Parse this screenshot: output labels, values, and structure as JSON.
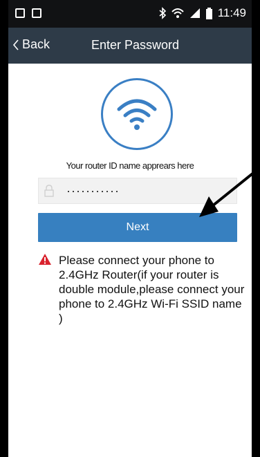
{
  "status_bar": {
    "time": "11:49"
  },
  "nav": {
    "back_label": "Back",
    "title": "Enter Password"
  },
  "main": {
    "router_label": "Your router ID name apprears here",
    "password_value": "···········",
    "next_label": "Next",
    "warning_text": "Please connect your phone to 2.4GHz Router(if your router is double module,please connect your phone to 2.4GHz Wi-Fi SSID name )"
  },
  "colors": {
    "nav_background": "#2e3b48",
    "accent": "#3780c0",
    "wifi_icon": "#3a7fc4",
    "warning": "#d9232e"
  },
  "icons": {
    "back": "chevron-left-icon",
    "wifi": "wifi-icon",
    "lock": "lock-icon",
    "warning": "warning-triangle-icon"
  }
}
